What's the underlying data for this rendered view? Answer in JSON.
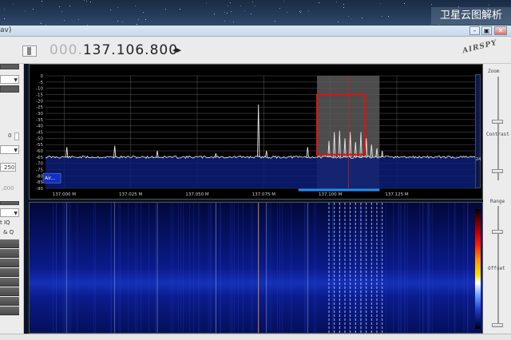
{
  "watermark": "卫星云图解析",
  "window": {
    "title_fragment": "av)",
    "minimize_glyph": "–",
    "restore_glyph": "▣",
    "close_glyph": "✕"
  },
  "toolbar": {
    "frequency_dim": "000.",
    "frequency_bright": "137.106.800",
    "frequency_arrows": "◂▸",
    "logo": "AIRSPY"
  },
  "left_panel": {
    "value_0": "0",
    "value_250": "250",
    "value_000": ",000",
    "swap_iq": "t IQ",
    "i_and_q": "& Q"
  },
  "right_controls": {
    "zoom": "Zoom",
    "contrast": "Contrast",
    "range": "Range",
    "offset": "Offset",
    "scroll_value": "24"
  },
  "colors": {
    "accent_blue": "#1a8cff",
    "box_red": "#e01010",
    "center_red": "#d02020",
    "trace": "#e8e8e8"
  },
  "spectrum": {
    "y_labels": [
      "0",
      "-5",
      "-10",
      "-15",
      "-20",
      "-25",
      "-30",
      "-35",
      "-40",
      "-45",
      "-50",
      "-55",
      "-60",
      "-65",
      "-70",
      "-75",
      "-80",
      "-85",
      "-90"
    ],
    "x_labels": [
      "137.000 M",
      "137.025 M",
      "137.050 M",
      "137.075 M",
      "137.100 M",
      "137.125 M"
    ],
    "x_values": [
      137.0,
      137.025,
      137.05,
      137.075,
      137.1,
      137.125
    ],
    "x_range": [
      136.993,
      137.155
    ],
    "y_range": [
      0,
      -90
    ],
    "center_freq": 137.1068,
    "filter_band": [
      137.095,
      137.1185
    ],
    "selection_box": {
      "f_start": 137.095,
      "f_end": 137.113,
      "db_top": -15,
      "db_bottom": -63
    },
    "noise_floor_db": -65,
    "peaks": [
      {
        "f": 137.001,
        "db": -57
      },
      {
        "f": 137.019,
        "db": -56
      },
      {
        "f": 137.035,
        "db": -60
      },
      {
        "f": 137.057,
        "db": -62
      },
      {
        "f": 137.073,
        "db": -23
      },
      {
        "f": 137.076,
        "db": -60
      },
      {
        "f": 137.0915,
        "db": -57
      },
      {
        "f": 137.0995,
        "db": -52
      },
      {
        "f": 137.1015,
        "db": -45
      },
      {
        "f": 137.1035,
        "db": -44
      },
      {
        "f": 137.1055,
        "db": -50
      },
      {
        "f": 137.1075,
        "db": -45
      },
      {
        "f": 137.1095,
        "db": -53
      },
      {
        "f": 137.1115,
        "db": -45
      },
      {
        "f": 137.1135,
        "db": -50
      },
      {
        "f": 137.1155,
        "db": -55
      },
      {
        "f": 137.1175,
        "db": -58
      },
      {
        "f": 137.1195,
        "db": -60
      }
    ],
    "legend_label": "Air..."
  }
}
